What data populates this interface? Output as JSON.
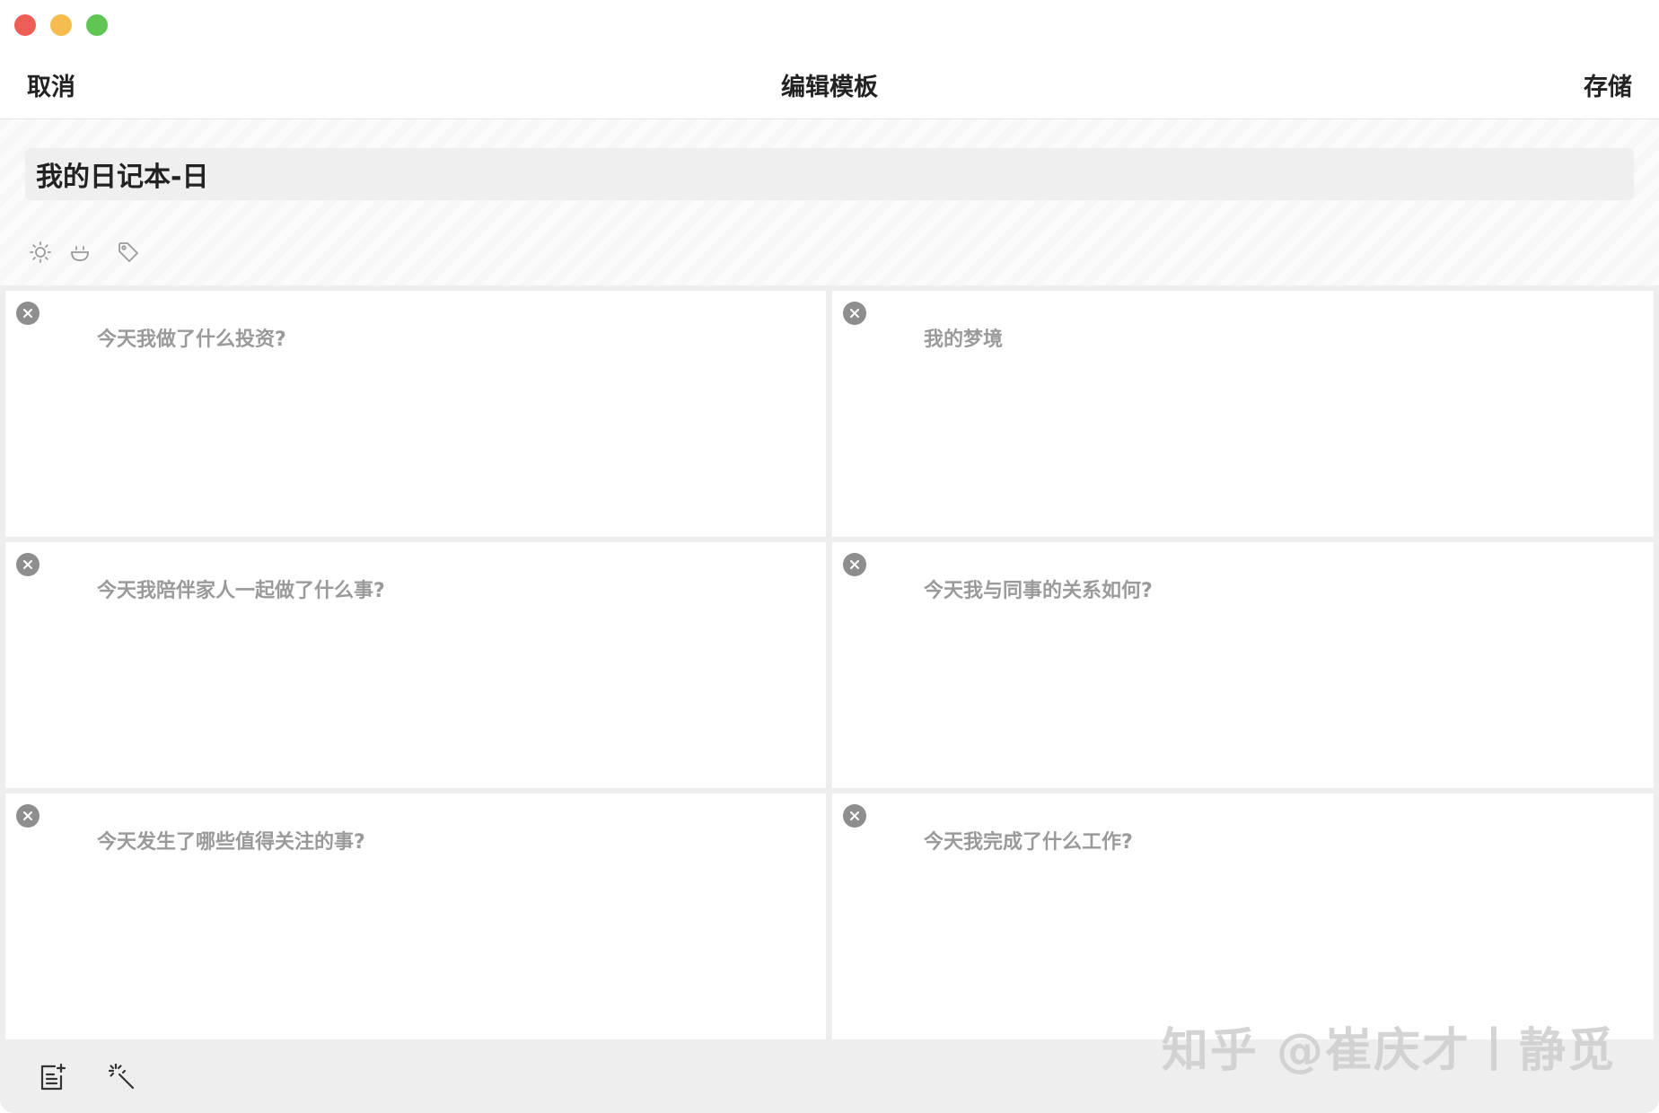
{
  "window": {
    "colors": {
      "close": "#ee5f57",
      "minimize": "#f5bd4f",
      "maximize": "#61c554"
    }
  },
  "navbar": {
    "cancel_label": "取消",
    "title": "编辑模板",
    "save_label": "存储"
  },
  "template": {
    "name_value": "我的日记本-日",
    "icons": [
      "sun-icon",
      "smile-icon",
      "tag-icon"
    ]
  },
  "prompts": [
    {
      "text": "今天我做了什么投资?"
    },
    {
      "text": "我的梦境"
    },
    {
      "text": "今天我陪伴家人一起做了什么事?"
    },
    {
      "text": "今天我与同事的关系如何?"
    },
    {
      "text": "今天发生了哪些值得关注的事?"
    },
    {
      "text": "今天我完成了什么工作?"
    }
  ],
  "bottom_toolbar": {
    "icons": [
      "add-note-icon",
      "magic-wand-icon"
    ]
  },
  "watermark": "知乎 @崔庆才丨静觅"
}
